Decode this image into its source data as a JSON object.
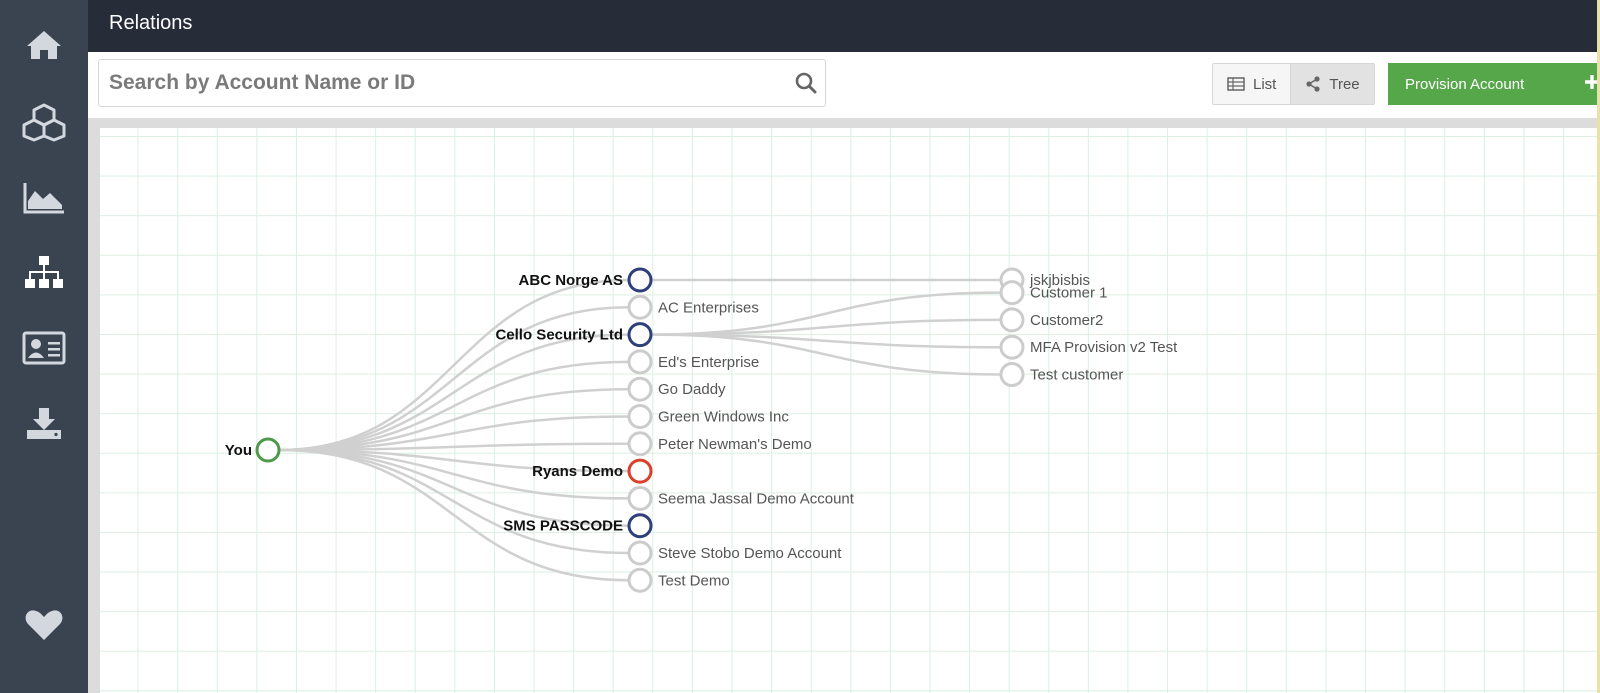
{
  "header": {
    "title": "Relations"
  },
  "sidebar": {
    "items": [
      {
        "icon": "home-icon"
      },
      {
        "icon": "cubes-icon"
      },
      {
        "icon": "area-chart-icon"
      },
      {
        "icon": "sitemap-icon",
        "active": true
      },
      {
        "icon": "contact-card-icon"
      },
      {
        "icon": "download-icon"
      }
    ],
    "bottom_icon": "heart-icon"
  },
  "search": {
    "placeholder": "Search by Account Name or ID",
    "value": ""
  },
  "view_toggle": {
    "options": [
      {
        "label": "List",
        "icon": "table-icon",
        "active": false
      },
      {
        "label": "Tree",
        "icon": "share-icon",
        "active": true
      }
    ]
  },
  "provision_button": {
    "label": "Provision Account"
  },
  "colors": {
    "root": "#4f9a4a",
    "parent": "#2f3f7a",
    "alert": "#d9412b",
    "leaf": "#cccccc",
    "link": "#d0d0d0"
  },
  "tree": {
    "root": "You",
    "children": [
      {
        "label": "ABC Norge AS",
        "kind": "parent",
        "children": [
          {
            "label": "jskjbisbis"
          }
        ]
      },
      {
        "label": "AC Enterprises",
        "kind": "leaf"
      },
      {
        "label": "Cello Security Ltd",
        "kind": "parent",
        "children": [
          {
            "label": "Customer 1"
          },
          {
            "label": "Customer2"
          },
          {
            "label": "MFA Provision v2 Test"
          },
          {
            "label": "Test customer"
          }
        ]
      },
      {
        "label": "Ed's Enterprise",
        "kind": "leaf"
      },
      {
        "label": "Go Daddy",
        "kind": "leaf"
      },
      {
        "label": "Green Windows Inc",
        "kind": "leaf"
      },
      {
        "label": "Peter Newman's Demo",
        "kind": "leaf"
      },
      {
        "label": "Ryans Demo",
        "kind": "alert"
      },
      {
        "label": "Seema Jassal Demo Account",
        "kind": "leaf"
      },
      {
        "label": "SMS PASSCODE",
        "kind": "parent"
      },
      {
        "label": "Steve Stobo Demo Account",
        "kind": "leaf"
      },
      {
        "label": "Test Demo",
        "kind": "leaf"
      }
    ]
  }
}
